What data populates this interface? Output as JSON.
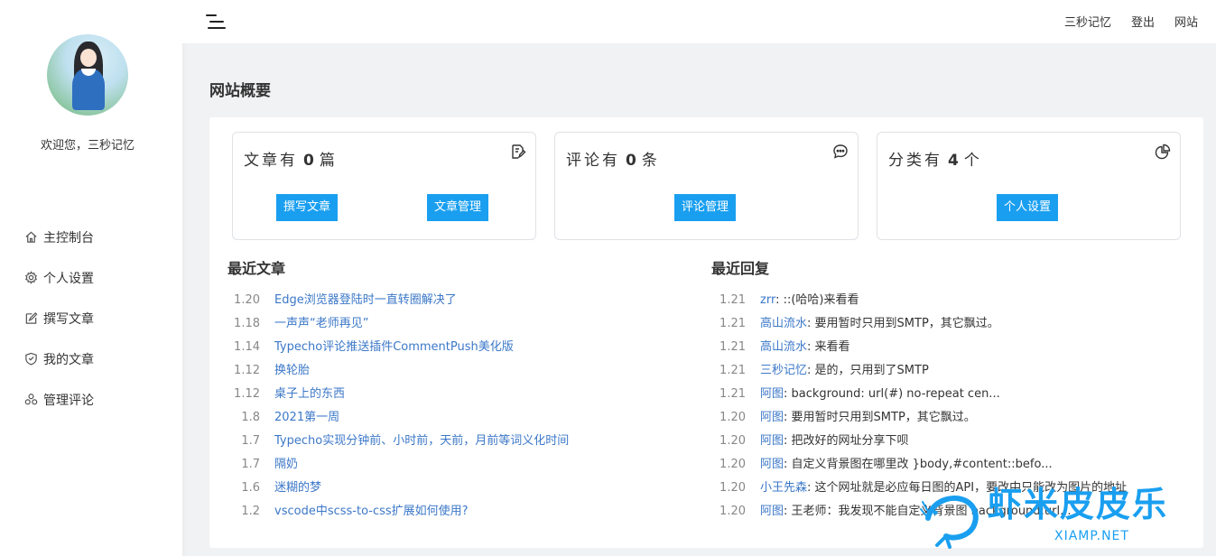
{
  "sidebar": {
    "welcome": "欢迎您，三秒记忆",
    "items": [
      {
        "label": "主控制台",
        "icon": "home-icon"
      },
      {
        "label": "个人设置",
        "icon": "gear-icon"
      },
      {
        "label": "撰写文章",
        "icon": "edit-icon"
      },
      {
        "label": "我的文章",
        "icon": "shield-icon"
      },
      {
        "label": "管理评论",
        "icon": "comments-icon"
      }
    ]
  },
  "header": {
    "links": [
      "三秒记忆",
      "登出",
      "网站"
    ]
  },
  "main": {
    "title": "网站概要",
    "cards": [
      {
        "prefix": "文章有",
        "count": "0",
        "unit": "篇",
        "icon": "document-edit-icon",
        "buttons": [
          "撰写文章",
          "文章管理"
        ]
      },
      {
        "prefix": "评论有",
        "count": "0",
        "unit": "条",
        "icon": "chat-icon",
        "buttons": [
          "评论管理"
        ]
      },
      {
        "prefix": "分类有",
        "count": "4",
        "unit": "个",
        "icon": "pie-chart-icon",
        "buttons": [
          "个人设置"
        ]
      }
    ],
    "recent_posts_title": "最近文章",
    "recent_posts": [
      {
        "date": "1.20",
        "title": "Edge浏览器登陆时一直转圈解决了"
      },
      {
        "date": "1.18",
        "title": "一声声“老师再见”"
      },
      {
        "date": "1.14",
        "title": "Typecho评论推送插件CommentPush美化版"
      },
      {
        "date": "1.12",
        "title": "换轮胎"
      },
      {
        "date": "1.12",
        "title": "桌子上的东西"
      },
      {
        "date": "1.8",
        "title": "2021第一周"
      },
      {
        "date": "1.7",
        "title": "Typecho实现分钟前、小时前，天前，月前等词义化时间"
      },
      {
        "date": "1.7",
        "title": "隔奶"
      },
      {
        "date": "1.6",
        "title": "迷糊的梦"
      },
      {
        "date": "1.2",
        "title": "vscode中scss-to-css扩展如何使用?"
      }
    ],
    "recent_replies_title": "最近回复",
    "recent_replies": [
      {
        "date": "1.21",
        "author": "zrr",
        "text": "::(哈哈)来看看"
      },
      {
        "date": "1.21",
        "author": "高山流水",
        "text": "要用暂时只用到SMTP，其它飘过。"
      },
      {
        "date": "1.21",
        "author": "高山流水",
        "text": "来看看"
      },
      {
        "date": "1.21",
        "author": "三秒记忆",
        "text": "是的，只用到了SMTP"
      },
      {
        "date": "1.21",
        "author": "阿图",
        "text": "background: url(#) no-repeat cen..."
      },
      {
        "date": "1.20",
        "author": "阿图",
        "text": "要用暂时只用到SMTP，其它飘过。"
      },
      {
        "date": "1.20",
        "author": "阿图",
        "text": "把改好的网址分享下呗"
      },
      {
        "date": "1.20",
        "author": "阿图",
        "text": "自定义背景图在哪里改 }body,#content::befo..."
      },
      {
        "date": "1.20",
        "author": "小王先森",
        "text": "这个网址就是必应每日图的API，要改中只能改为图片的地址"
      },
      {
        "date": "1.20",
        "author": "阿图",
        "text": "王老师：我发现不能自定义背景图 background:url..."
      }
    ]
  },
  "watermark": {
    "text": "虾米皮皮乐",
    "sub": "XIAMP.NET"
  },
  "colors": {
    "accent": "#1a9ff0",
    "link": "#3c78c8"
  }
}
